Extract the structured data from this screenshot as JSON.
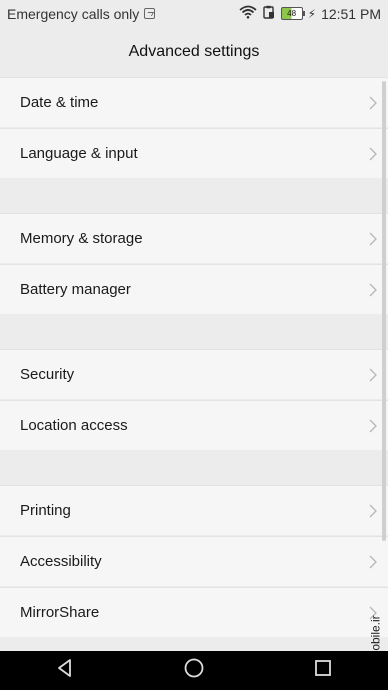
{
  "status_bar": {
    "left_text": "Emergency calls only",
    "battery_level": "48",
    "time": "12:51 PM",
    "icons": [
      "sim-icon",
      "wifi-icon",
      "notification-icon",
      "battery-icon",
      "charging-icon"
    ]
  },
  "header": {
    "title": "Advanced settings"
  },
  "rows": [
    {
      "label": "Date & time"
    },
    {
      "label": "Language & input"
    },
    {
      "label": "Memory & storage"
    },
    {
      "label": "Battery manager"
    },
    {
      "label": "Security"
    },
    {
      "label": "Location access"
    },
    {
      "label": "Printing"
    },
    {
      "label": "Accessibility"
    },
    {
      "label": "MirrorShare"
    }
  ],
  "navbar": {
    "icons": [
      "back-icon",
      "home-icon",
      "recents-icon"
    ]
  },
  "watermark": "mobile.ir"
}
